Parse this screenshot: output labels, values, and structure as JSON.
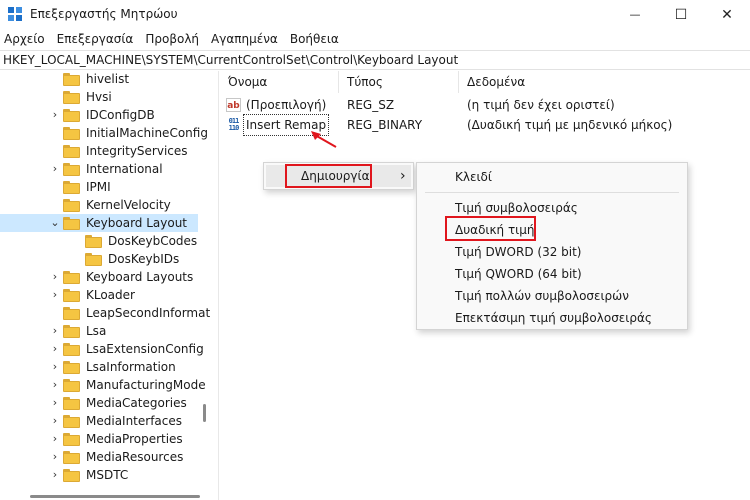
{
  "window": {
    "title": "Επεξεργαστής Μητρώου",
    "controls": {
      "minimize": "—",
      "maximize": "☐",
      "close": "✕"
    }
  },
  "menubar": [
    "Αρχείο",
    "Επεξεργασία",
    "Προβολή",
    "Αγαπημένα",
    "Βοήθεια"
  ],
  "address": "HKEY_LOCAL_MACHINE\\SYSTEM\\CurrentControlSet\\Control\\Keyboard Layout",
  "tree": [
    {
      "label": "hivelist",
      "expander": "",
      "depth": 0
    },
    {
      "label": "Hvsi",
      "expander": "",
      "depth": 0
    },
    {
      "label": "IDConfigDB",
      "expander": "›",
      "depth": 0
    },
    {
      "label": "InitialMachineConfig",
      "expander": "",
      "depth": 0
    },
    {
      "label": "IntegrityServices",
      "expander": "",
      "depth": 0
    },
    {
      "label": "International",
      "expander": "›",
      "depth": 0
    },
    {
      "label": "IPMI",
      "expander": "",
      "depth": 0
    },
    {
      "label": "KernelVelocity",
      "expander": "",
      "depth": 0
    },
    {
      "label": "Keyboard Layout",
      "expander": "⌄",
      "depth": 0,
      "selected": true
    },
    {
      "label": "DosKeybCodes",
      "expander": "",
      "depth": 1
    },
    {
      "label": "DosKeybIDs",
      "expander": "",
      "depth": 1
    },
    {
      "label": "Keyboard Layouts",
      "expander": "›",
      "depth": 0
    },
    {
      "label": "KLoader",
      "expander": "›",
      "depth": 0
    },
    {
      "label": "LeapSecondInformat",
      "expander": "",
      "depth": 0
    },
    {
      "label": "Lsa",
      "expander": "›",
      "depth": 0
    },
    {
      "label": "LsaExtensionConfig",
      "expander": "›",
      "depth": 0
    },
    {
      "label": "LsaInformation",
      "expander": "›",
      "depth": 0
    },
    {
      "label": "ManufacturingMode",
      "expander": "›",
      "depth": 0
    },
    {
      "label": "MediaCategories",
      "expander": "›",
      "depth": 0
    },
    {
      "label": "MediaInterfaces",
      "expander": "›",
      "depth": 0
    },
    {
      "label": "MediaProperties",
      "expander": "›",
      "depth": 0
    },
    {
      "label": "MediaResources",
      "expander": "›",
      "depth": 0
    },
    {
      "label": "MSDTC",
      "expander": "›",
      "depth": 0
    }
  ],
  "list": {
    "columns": [
      "Όνομα",
      "Τύπος",
      "Δεδομένα"
    ],
    "rows": [
      {
        "icon": "string-value-icon",
        "icon_text": "ab",
        "name": "(Προεπιλογή)",
        "type": "REG_SZ",
        "data": "(η τιμή δεν έχει οριστεί)"
      },
      {
        "icon": "binary-value-icon",
        "icon_text": "011\n110",
        "name": "Insert Remap",
        "type": "REG_BINARY",
        "data": "(Δυαδική τιμή με μηδενικό μήκος)",
        "focused": true
      }
    ]
  },
  "context_menu": {
    "new_label": "Δημιουργία",
    "submenu_arrow": "›"
  },
  "submenu": {
    "key": "Κλειδί",
    "items": [
      "Τιμή συμβολοσειράς",
      "Δυαδική τιμή",
      "Τιμή DWORD (32 bit)",
      "Τιμή QWORD (64 bit)",
      "Τιμή πολλών συμβολοσειρών",
      "Επεκτάσιμη τιμή συμβολοσειράς"
    ]
  },
  "colors": {
    "highlight": "#e0161d",
    "selection": "#cce8ff",
    "folder": "#f5c542"
  }
}
